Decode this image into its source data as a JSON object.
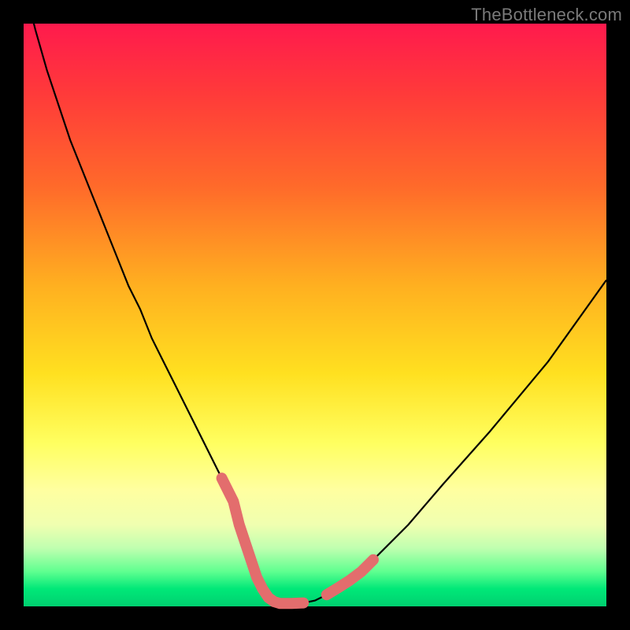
{
  "watermark": "TheBottleneck.com",
  "chart_data": {
    "type": "line",
    "title": "",
    "xlabel": "",
    "ylabel": "",
    "xlim": [
      0,
      100
    ],
    "ylim": [
      0,
      100
    ],
    "series": [
      {
        "name": "bottleneck-curve",
        "x": [
          0,
          2,
          4,
          6,
          8,
          10,
          12,
          14,
          16,
          18,
          20,
          22,
          24,
          26,
          28,
          30,
          32,
          34,
          36,
          37,
          38,
          39,
          40,
          41,
          42,
          43,
          44,
          46,
          48,
          50,
          52,
          56,
          60,
          66,
          72,
          80,
          90,
          100
        ],
        "values": [
          107,
          99,
          92,
          86,
          80,
          75,
          70,
          65,
          60,
          55,
          51,
          46,
          42,
          38,
          34,
          30,
          26,
          22,
          18,
          14,
          11,
          8,
          5,
          3,
          1.5,
          0.8,
          0.5,
          0.5,
          0.6,
          1.0,
          2.0,
          4.5,
          8,
          14,
          21,
          30,
          42,
          56
        ]
      }
    ],
    "highlights": {
      "name": "near-bottom-segments",
      "color": "#e36d6d",
      "segments": [
        {
          "x": [
            34,
            36,
            37,
            38,
            39,
            40,
            41,
            42,
            43,
            44,
            46,
            48
          ],
          "values": [
            22,
            18,
            14,
            11,
            8,
            5,
            3,
            1.5,
            0.8,
            0.5,
            0.5,
            0.6
          ]
        },
        {
          "x": [
            52,
            54,
            56,
            58,
            60
          ],
          "values": [
            2.0,
            3.2,
            4.5,
            6.0,
            8.0
          ]
        }
      ]
    },
    "gradient_stops": [
      {
        "pos": 0,
        "color": "#ff1a4d"
      },
      {
        "pos": 12,
        "color": "#ff3a3a"
      },
      {
        "pos": 28,
        "color": "#ff6a2a"
      },
      {
        "pos": 45,
        "color": "#ffb020"
      },
      {
        "pos": 60,
        "color": "#ffe020"
      },
      {
        "pos": 72,
        "color": "#ffff60"
      },
      {
        "pos": 80,
        "color": "#ffffa0"
      },
      {
        "pos": 86,
        "color": "#f0ffb0"
      },
      {
        "pos": 90,
        "color": "#c0ffb0"
      },
      {
        "pos": 94,
        "color": "#60ff90"
      },
      {
        "pos": 97,
        "color": "#00e878"
      },
      {
        "pos": 100,
        "color": "#00d070"
      }
    ]
  }
}
